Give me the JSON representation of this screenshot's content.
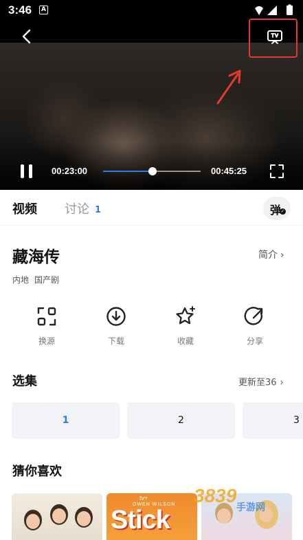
{
  "status_bar": {
    "time": "3:46",
    "app_indicator": "A",
    "icons": [
      "wifi-icon",
      "signal-icon",
      "battery-icon"
    ]
  },
  "player": {
    "current_time": "00:23:00",
    "total_time": "00:45:25",
    "progress_fraction": 0.51,
    "accent_color": "#2b7de9",
    "highlight_color": "#e53935",
    "icons": [
      "back-icon",
      "cast-tv-icon",
      "pause-icon",
      "fullscreen-icon"
    ]
  },
  "tabs": {
    "video": "视频",
    "discussion": "讨论",
    "discussion_count": "1",
    "danmu": "弹"
  },
  "show": {
    "title": "藏海传",
    "intro_label": "简介",
    "tags": [
      "内地",
      "国产剧"
    ]
  },
  "actions": [
    {
      "label": "换源",
      "icon": "switch-source-icon"
    },
    {
      "label": "下载",
      "icon": "download-icon"
    },
    {
      "label": "收藏",
      "icon": "favorite-star-icon"
    },
    {
      "label": "分享",
      "icon": "share-icon"
    }
  ],
  "episodes": {
    "title": "选集",
    "update_label": "更新至36",
    "items": [
      "1",
      "2",
      "3"
    ],
    "selected": "1"
  },
  "recommend": {
    "title": "猜你喜欢",
    "poster_texts": {
      "brand": "tv+",
      "sub": "OWEN WILSON",
      "big": "Stick"
    }
  },
  "watermark": {
    "big": "3839",
    "small": "手游网"
  }
}
